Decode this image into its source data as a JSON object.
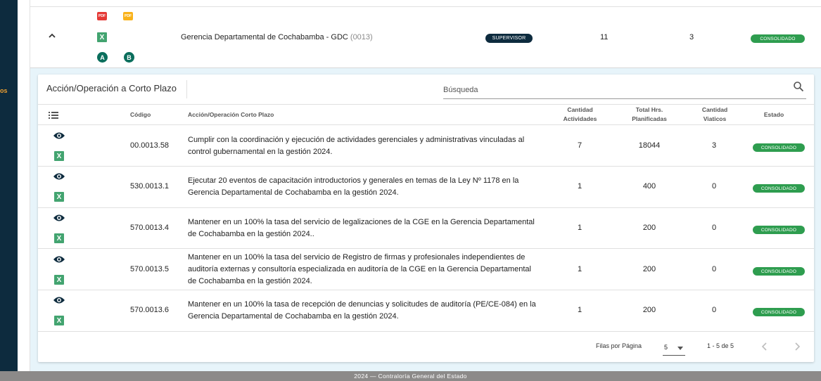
{
  "sidebar": {
    "partial_label": "os"
  },
  "parent": {
    "icons": [
      "pdf-icon",
      "pdf-icon",
      "excel-icon",
      "a-badge-icon",
      "b-badge-icon"
    ],
    "pdf_label": "PDF",
    "pdf_label_2": "PDF",
    "excel_label": "X",
    "badge_a": "A",
    "badge_b": "B",
    "name": "Gerencia Departamental de Cochabamba - GDC",
    "code": "(0013)",
    "role": "SUPERVISOR",
    "value1": "11",
    "value2": "3",
    "status": "CONSOLIDADO"
  },
  "card": {
    "title": "Acción/Operación a Corto Plazo",
    "search_placeholder": "Búsqueda"
  },
  "table": {
    "headers": {
      "code": "Código",
      "desc": "Acción/Operación Corto Plazo",
      "activities_1": "Cantidad",
      "activities_2": "Actividades",
      "hours_1": "Total Hrs.",
      "hours_2": "Planificadas",
      "viaticos_1": "Cantidad",
      "viaticos_2": "Viaticos",
      "status": "Estado"
    },
    "excel_label": "X",
    "rows": [
      {
        "code": "00.0013.58",
        "desc": "Cumplir con la coordinación y ejecución de actividades gerenciales y administrativas vinculadas al control gubernamental en la gestión 2024.",
        "activities": "7",
        "hours": "18044",
        "viaticos": "3",
        "status": "CONSOLIDADO"
      },
      {
        "code": "530.0013.1",
        "desc": "Ejecutar 20 eventos de capacitación introductorios y generales en temas de la Ley Nº 1178 en la Gerencia Departamental de Cochabamba en la gestión 2024.",
        "activities": "1",
        "hours": "400",
        "viaticos": "0",
        "status": "CONSOLIDADO"
      },
      {
        "code": "570.0013.4",
        "desc": "Mantener en un 100% la tasa del servicio de legalizaciones de la CGE en la Gerencia Departamental de Cochabamba en la gestión 2024..",
        "activities": "1",
        "hours": "200",
        "viaticos": "0",
        "status": "CONSOLIDADO"
      },
      {
        "code": "570.0013.5",
        "desc": "Mantener en un 100% la tasa del servicio de Registro de firmas y profesionales independientes de auditoría externas y consultoría especializada en auditoría de la CGE en la Gerencia Departamental de Cochabamba en la gestión 2024.",
        "activities": "1",
        "hours": "200",
        "viaticos": "0",
        "status": "CONSOLIDADO"
      },
      {
        "code": "570.0013.6",
        "desc": "Mantener en un 100% la tasa de recepción de denuncias y solicitudes de auditoría (PE/CE-084) en la Gerencia Departamental de Cochabamba en la gestión 2024.",
        "activities": "1",
        "hours": "200",
        "viaticos": "0",
        "status": "CONSOLIDADO"
      }
    ]
  },
  "pagination": {
    "rows_label": "Filas por Página",
    "rows_value": "5",
    "range": "1 - 5 de 5"
  },
  "footer": {
    "text": "2024 — Contraloría General del Estado"
  },
  "colors": {
    "sidebar": "#0d2b3e",
    "status_green": "#2e9d4f",
    "expanded_bg": "#e7f4fa",
    "excel_green": "#43a470",
    "pdf_red": "#e53935",
    "pdf_yellow": "#f9b21a"
  }
}
